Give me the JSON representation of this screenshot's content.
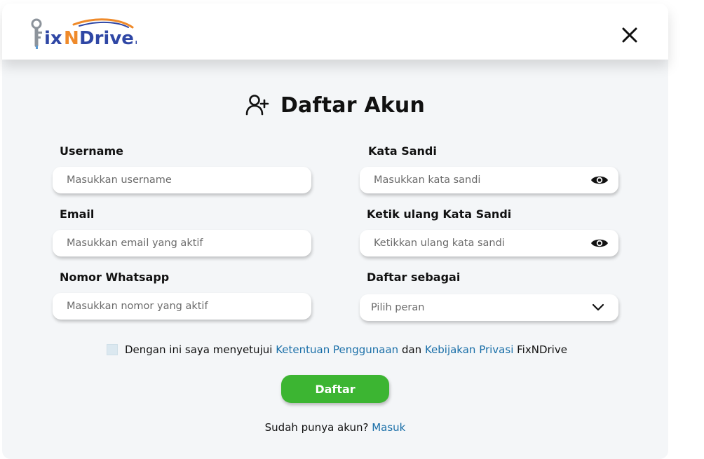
{
  "header": {
    "logo_text": "FixNDrive.",
    "logo_icon": "wrench-key-icon",
    "close_icon": "close-icon"
  },
  "title": {
    "text": "Daftar Akun",
    "icon": "add-user-icon"
  },
  "form": {
    "username": {
      "label": "Username",
      "placeholder": "Masukkan username"
    },
    "password": {
      "label": "Kata Sandi",
      "placeholder": "Masukkan kata sandi",
      "icon": "eye-icon"
    },
    "email": {
      "label": "Email",
      "placeholder": "Masukkan email yang aktif"
    },
    "confirm_password": {
      "label": "Ketik ulang Kata Sandi",
      "placeholder": "Ketikkan ulang kata sandi",
      "icon": "eye-icon"
    },
    "whatsapp": {
      "label": "Nomor Whatsapp",
      "placeholder": "Masukkan nomor yang aktif"
    },
    "role": {
      "label": "Daftar sebagai",
      "selected": "Pilih peran",
      "icon": "chevron-down-icon"
    }
  },
  "terms": {
    "prefix": "Dengan ini saya menyetujui ",
    "terms_link": "Ketentuan Penggunaan",
    "middle": " dan ",
    "privacy_link": "Kebijakan Privasi",
    "suffix": " FixNDrive",
    "checked": false
  },
  "submit_label": "Daftar",
  "login": {
    "prompt": "Sudah punya akun? ",
    "link": "Masuk"
  },
  "colors": {
    "brand_blue": "#2f47a5",
    "brand_orange": "#ef8a2a",
    "submit_green": "#3cb532",
    "link_blue": "#1a6fa8",
    "panel_bg": "#f4f6f8"
  }
}
